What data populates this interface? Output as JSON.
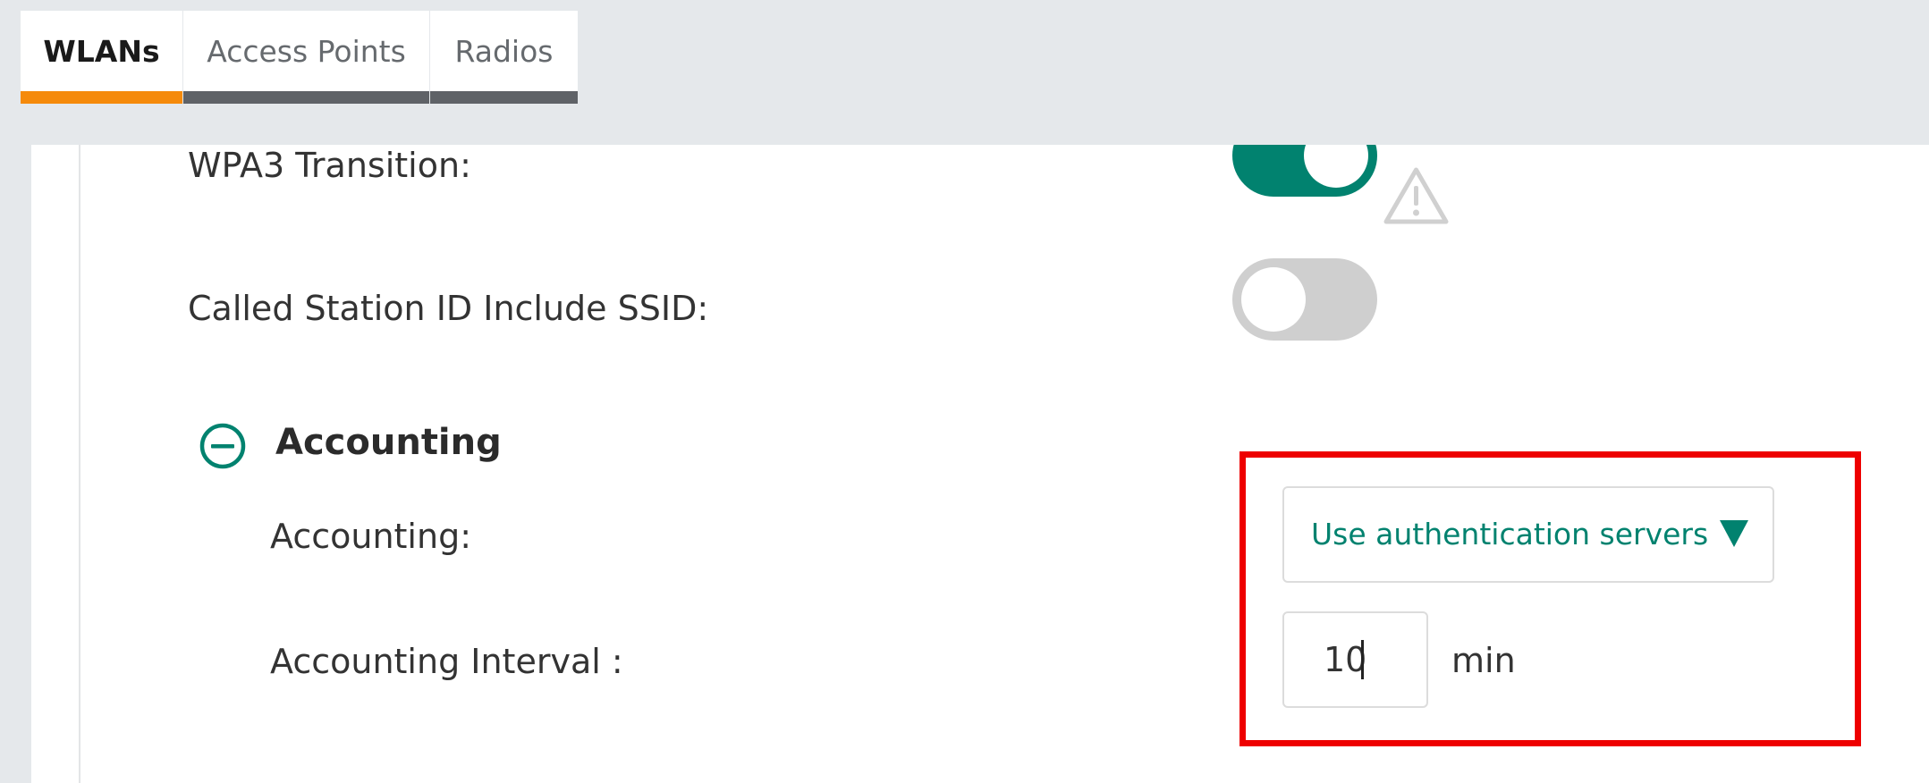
{
  "tabs": [
    {
      "label": "WLANs",
      "active": true
    },
    {
      "label": "Access Points",
      "active": false
    },
    {
      "label": "Radios",
      "active": false
    }
  ],
  "settings": {
    "wpa3_transition": {
      "label": "WPA3 Transition:",
      "enabled": true
    },
    "called_station_id": {
      "label": "Called Station ID Include SSID:",
      "enabled": false
    }
  },
  "accounting_section": {
    "title": "Accounting",
    "accounting": {
      "label": "Accounting:",
      "selected": "Use authentication servers"
    },
    "interval": {
      "label": "Accounting Interval :",
      "value": "10",
      "unit": "min"
    }
  },
  "icons": {
    "warning": "warning-triangle-icon",
    "collapse": "minus-circle-icon",
    "dropdown": "triangle-down-icon"
  },
  "colors": {
    "accent": "#01826f",
    "active_tab_underline": "#f58a0b",
    "inactive_tab_underline": "#5f6267",
    "highlight": "#ee0000",
    "toggle_off": "#cfcfcf"
  }
}
